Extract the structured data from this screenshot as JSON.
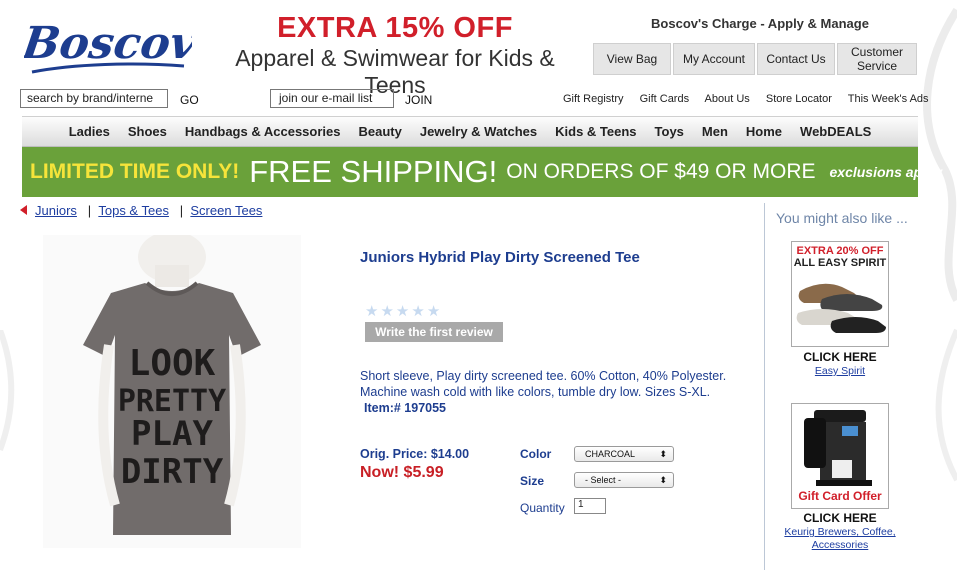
{
  "header": {
    "logo_text": "Boscov's",
    "promo_headline": "EXTRA 15% OFF",
    "promo_sub": "Apparel & Swimwear for Kids & Teens",
    "charge_text": "Boscov's Charge - Apply & Manage",
    "buttons": {
      "view_bag": "View Bag",
      "my_account": "My Account",
      "contact_us": "Contact Us",
      "customer_service": "Customer Service"
    },
    "search_value": "search by brand/interne",
    "go_label": "GO",
    "email_value": "join our e-mail list",
    "join_label": "JOIN",
    "util_links": [
      "Gift Registry",
      "Gift Cards",
      "About Us",
      "Store Locator",
      "This Week's Ads"
    ]
  },
  "nav": {
    "items": [
      "Ladies",
      "Shoes",
      "Handbags & Accessories",
      "Beauty",
      "Jewelry & Watches",
      "Kids & Teens",
      "Toys",
      "Men",
      "Home",
      "WebDEALS"
    ]
  },
  "banner": {
    "part1": "LIMITED TIME ONLY!",
    "part2": "FREE SHIPPING!",
    "part3": "ON ORDERS OF $49 OR MORE",
    "part4": "exclusions apply"
  },
  "breadcrumb": [
    "Juniors",
    "Tops & Tees",
    "Screen Tees"
  ],
  "product": {
    "title": "Juniors Hybrid Play Dirty Screened Tee",
    "shirt_text": [
      "LOOK",
      "PRETTY",
      "PLAY",
      "DIRTY"
    ],
    "review_label": "Write the first review",
    "description": "Short sleeve, Play dirty screened tee. 60% Cotton, 40% Polyester. Machine wash cold with like colors, tumble dry low. Sizes S-XL.",
    "item_label": "Item:# 197055",
    "orig_price": "Orig. Price: $14.00",
    "now_price": "Now! $5.99",
    "color_label": "Color",
    "color_value": "CHARCOAL",
    "size_label": "Size",
    "size_value": "- Select -",
    "quantity_label": "Quantity",
    "quantity_value": "1"
  },
  "sidebar": {
    "heading": "You might also like ...",
    "ads": [
      {
        "top": "EXTRA 20% OFF",
        "top2": "ALL EASY SPIRIT",
        "cta": "CLICK HERE",
        "link": "Easy Spirit"
      },
      {
        "top": "Gift Card Offer",
        "cta": "CLICK HERE",
        "link": "Keurig Brewers, Coffee, Accessories"
      }
    ]
  },
  "colors": {
    "brand_blue": "#1d3d8f",
    "promo_red": "#d11f2a",
    "banner_green": "#6aa13a",
    "banner_yellow": "#f6e43a",
    "price_red": "#c81f25"
  }
}
